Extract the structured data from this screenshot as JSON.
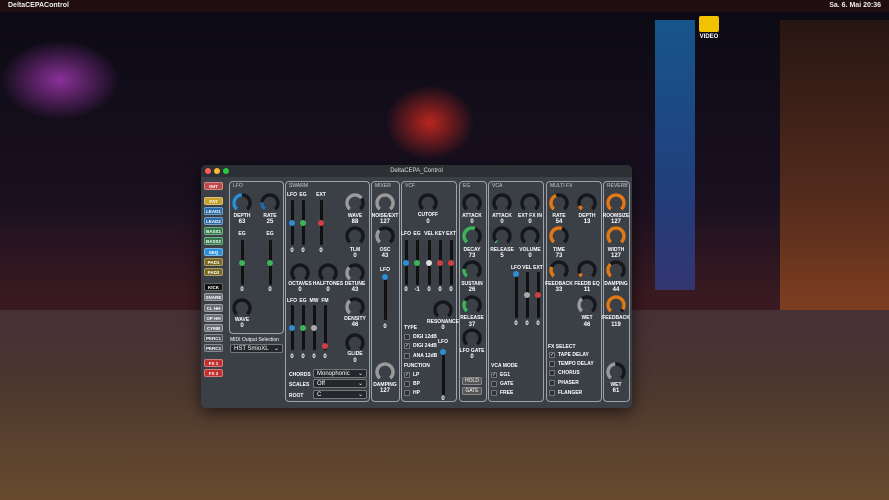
{
  "menubar": {
    "app": "DeltaCEPAControl",
    "clock": "Sa. 6. Mai 20:36"
  },
  "desktop": {
    "icon_label": "VIDEO"
  },
  "window": {
    "title": "DeltaCEPA_Control"
  },
  "presets": [
    {
      "label": "INIT",
      "color": "#c04848"
    },
    {
      "label": "FAT",
      "color": "#c8a030"
    },
    {
      "label": "LEAD1",
      "color": "#2a6aa8"
    },
    {
      "label": "LEAD2",
      "color": "#2a6aa8"
    },
    {
      "label": "BASS1",
      "color": "#2f7a48"
    },
    {
      "label": "BASS2",
      "color": "#2f7a48"
    },
    {
      "label": "SEQ",
      "color": "#2b8fd8"
    },
    {
      "label": "PAD1",
      "color": "#7a6a20"
    },
    {
      "label": "PAD2",
      "color": "#7a6a20"
    },
    {
      "label": "KICK",
      "color": "#111111"
    },
    {
      "label": "SNARE",
      "color": "#6a6e74"
    },
    {
      "label": "CL HH",
      "color": "#6a6e74"
    },
    {
      "label": "OP HH",
      "color": "#6a6e74"
    },
    {
      "label": "CYMB",
      "color": "#6a6e74"
    },
    {
      "label": "PERC1",
      "color": "#4a4e54"
    },
    {
      "label": "PERC2",
      "color": "#4a4e54"
    },
    {
      "label": "FX 1",
      "color": "#c03030"
    },
    {
      "label": "FX 2",
      "color": "#c03030"
    }
  ],
  "lfo": {
    "title": "LFO",
    "depth": {
      "label": "DEPTH",
      "value": "63",
      "color": "#2b8fd8"
    },
    "rate": {
      "label": "RATE",
      "value": "25",
      "color": "#1f6ab0"
    },
    "sliders": [
      {
        "label": "EG",
        "value": "0",
        "color": "#3cb45a"
      },
      {
        "label": "EG",
        "value": "0",
        "color": "#3cb45a"
      }
    ],
    "wave": {
      "label": "WAVE",
      "value": "0",
      "color": "#1f6ab0"
    }
  },
  "midi": {
    "label": "MIDI Output Selection",
    "selected": "HST SmioXL"
  },
  "swarm": {
    "title": "SWARM",
    "sliders1": [
      {
        "label": "LFO",
        "value": "0",
        "color": "#2b8fd8"
      },
      {
        "label": "EG",
        "value": "0",
        "color": "#3cb45a"
      },
      {
        "label": "EXT",
        "value": "0",
        "color": "#d04040"
      }
    ],
    "wave": {
      "label": "WAVE",
      "value": "88",
      "color": "#9a9a9a"
    },
    "tlm": {
      "label": "TLM",
      "value": "0",
      "color": "#9a9a9a"
    },
    "octaves": {
      "label": "OCTAVES",
      "value": "0",
      "color": "#9a9a9a"
    },
    "halftones": {
      "label": "HALFTONES",
      "value": "0",
      "color": "#9a9a9a"
    },
    "detune": {
      "label": "DETUNE",
      "value": "43",
      "color": "#9a9a9a"
    },
    "density": {
      "label": "DENSITY",
      "value": "46",
      "color": "#9a9a9a"
    },
    "glide": {
      "label": "GLIDE",
      "value": "0",
      "color": "#1f6ab0"
    },
    "sliders2": [
      {
        "label": "LFO",
        "value": "0",
        "color": "#2b8fd8"
      },
      {
        "label": "EG",
        "value": "0",
        "color": "#3cb45a"
      },
      {
        "label": "MW",
        "value": "0",
        "color": "#aaaaaa"
      },
      {
        "label": "FM",
        "value": "0",
        "color": "#d04040"
      }
    ],
    "chords": {
      "label": "CHORDS",
      "selected": "Monophonic"
    },
    "scales": {
      "label": "SCALES",
      "selected": "Off"
    },
    "root": {
      "label": "ROOT",
      "selected": "C"
    }
  },
  "mixer": {
    "title": "MIXER",
    "noise": {
      "label": "NOISE/EXT",
      "value": "127",
      "color": "#9a9a9a"
    },
    "osc": {
      "label": "OSC",
      "value": "43",
      "color": "#9a9a9a"
    },
    "lfo": {
      "label": "LFO",
      "value": "0",
      "color": "#2b8fd8"
    },
    "damping": {
      "label": "DAMPING",
      "value": "127",
      "color": "#9a9a9a"
    }
  },
  "vcf": {
    "title": "VCF",
    "cutoff": {
      "label": "CUTOFF",
      "value": "0",
      "color": "#9a9a9a"
    },
    "sliders": [
      {
        "label": "LFO",
        "value": "0",
        "color": "#2b8fd8"
      },
      {
        "label": "EG",
        "value": "-1",
        "color": "#3cb45a"
      },
      {
        "label": "VEL",
        "value": "0",
        "color": "#dddddd"
      },
      {
        "label": "KEY",
        "value": "0",
        "color": "#d04040"
      },
      {
        "label": "EXT",
        "value": "0",
        "color": "#d04040"
      }
    ],
    "resonance": {
      "label": "RESONANCE",
      "value": "0",
      "color": "#9a9a9a"
    },
    "type_label": "TYPE",
    "types": [
      {
        "label": "DIGI 12dB",
        "checked": false
      },
      {
        "label": "DIGI 24dB",
        "checked": true
      },
      {
        "label": "ANA 12dB",
        "checked": false
      }
    ],
    "function_label": "FUNCTION",
    "functions": [
      {
        "label": "LP",
        "checked": true
      },
      {
        "label": "BP",
        "checked": false
      },
      {
        "label": "HP",
        "checked": false
      }
    ],
    "lfo": {
      "label": "LFO",
      "value": "0",
      "color": "#2b8fd8"
    }
  },
  "eg": {
    "title": "EG",
    "attack": {
      "label": "ATTACK",
      "value": "0",
      "color": "#3cb45a"
    },
    "decay": {
      "label": "DECAY",
      "value": "73",
      "color": "#3cb45a"
    },
    "sustain": {
      "label": "SUSTAIN",
      "value": "26",
      "color": "#3cb45a"
    },
    "release": {
      "label": "RELEASE",
      "value": "37",
      "color": "#3cb45a"
    },
    "lfogate": {
      "label": "LFO GATE",
      "value": "0",
      "color": "#1f6ab0"
    },
    "hold": "HOLD",
    "gate": "GATE"
  },
  "vca": {
    "title": "VCA",
    "attack": {
      "label": "ATTACK",
      "value": "0",
      "color": "#3cb45a"
    },
    "extfx": {
      "label": "EXT FX IN",
      "value": "0",
      "color": "#9a9a9a"
    },
    "release": {
      "label": "RELEASE",
      "value": "5",
      "color": "#3cb45a"
    },
    "volume": {
      "label": "VOLUME",
      "value": "0",
      "color": "#9a9a9a"
    },
    "sliders": [
      {
        "label": "LFO",
        "value": "0",
        "color": "#2b8fd8"
      },
      {
        "label": "VEL",
        "value": "0",
        "color": "#aaaaaa"
      },
      {
        "label": "EXT",
        "value": "0",
        "color": "#d04040"
      }
    ],
    "mode_label": "VCA MODE",
    "modes": [
      {
        "label": "EG1",
        "checked": true
      },
      {
        "label": "GATE",
        "checked": false
      },
      {
        "label": "FREE",
        "checked": false
      }
    ]
  },
  "multifx": {
    "title": "MULTI FX",
    "rate": {
      "label": "RATE",
      "value": "54",
      "color": "#e07818"
    },
    "depth": {
      "label": "DEPTH",
      "value": "13",
      "color": "#e07818"
    },
    "time": {
      "label": "TIME",
      "value": "73",
      "color": "#e07818"
    },
    "feedback": {
      "label": "FEEDBACK",
      "value": "33",
      "color": "#e07818"
    },
    "feedbeq": {
      "label": "FEEDB EQ",
      "value": "11",
      "color": "#e07818"
    },
    "wet": {
      "label": "WET",
      "value": "46",
      "color": "#9a9a9a"
    },
    "select_label": "FX SELECT",
    "fx": [
      {
        "label": "TAPE DELAY",
        "checked": true
      },
      {
        "label": "TEMPO DELAY",
        "checked": false
      },
      {
        "label": "CHORUS",
        "checked": false
      },
      {
        "label": "PHASER",
        "checked": false
      },
      {
        "label": "FLANGER",
        "checked": false
      }
    ]
  },
  "reverb": {
    "title": "REVERB",
    "roomsize": {
      "label": "ROOMSIZE",
      "value": "127",
      "color": "#e07818"
    },
    "width": {
      "label": "WIDTH",
      "value": "127",
      "color": "#e07818"
    },
    "damping": {
      "label": "DAMPING",
      "value": "44",
      "color": "#e07818"
    },
    "feedback": {
      "label": "FEEDBACK",
      "value": "119",
      "color": "#e07818"
    },
    "wet": {
      "label": "WET",
      "value": "61",
      "color": "#9a9a9a"
    }
  }
}
